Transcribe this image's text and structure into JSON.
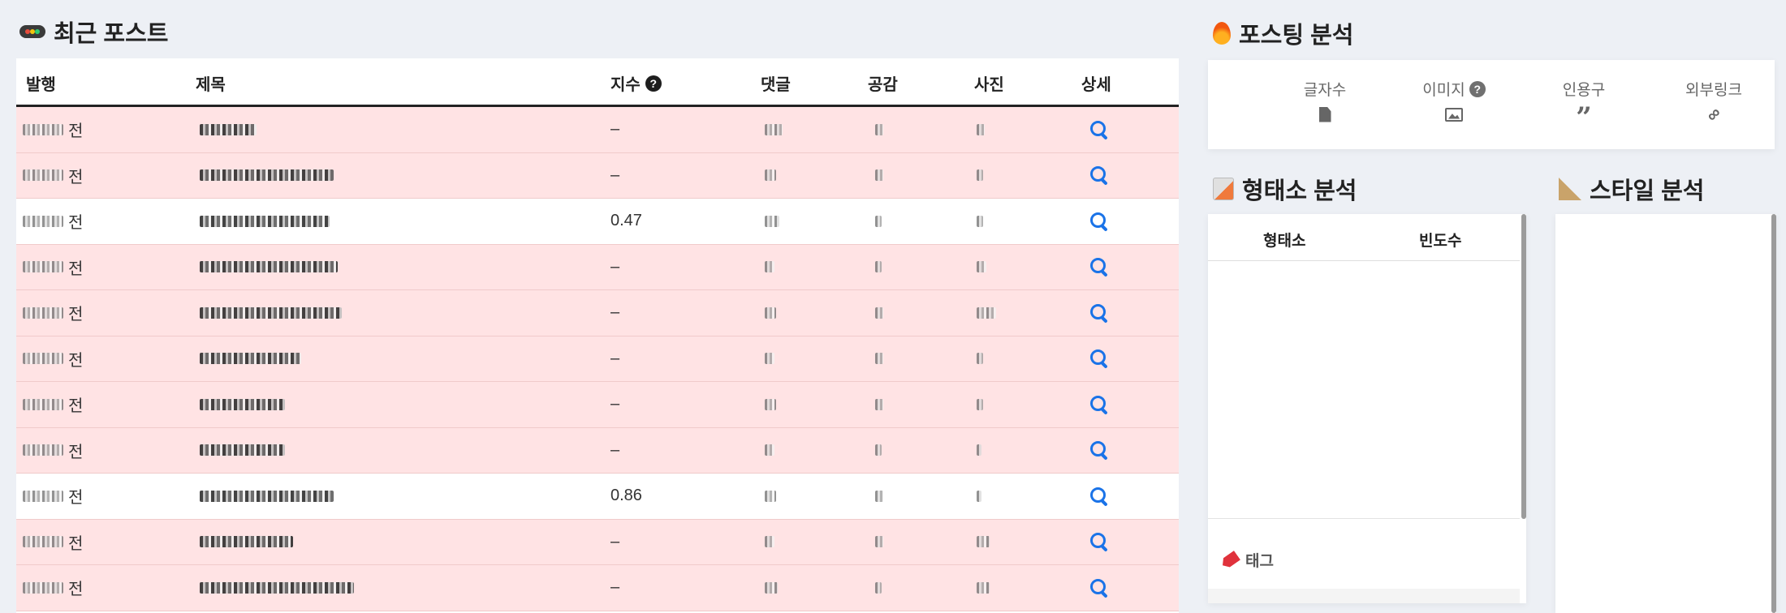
{
  "recent": {
    "title": "최근 포스트",
    "icon": "traffic-light-icon",
    "columns": {
      "published": "발행",
      "title": "제목",
      "index": "지수",
      "comments": "댓글",
      "likes": "공감",
      "photos": "사진",
      "detail": "상세"
    },
    "rows": [
      {
        "ago": "전",
        "index": "–",
        "highlight": true
      },
      {
        "ago": "전",
        "index": "–",
        "highlight": true
      },
      {
        "ago": "전",
        "index": "0.47",
        "highlight": false
      },
      {
        "ago": "전",
        "index": "–",
        "highlight": true
      },
      {
        "ago": "전",
        "index": "–",
        "highlight": true
      },
      {
        "ago": "전",
        "index": "–",
        "highlight": true
      },
      {
        "ago": "전",
        "index": "–",
        "highlight": true
      },
      {
        "ago": "전",
        "index": "–",
        "highlight": true
      },
      {
        "ago": "전",
        "index": "0.86",
        "highlight": false
      },
      {
        "ago": "전",
        "index": "–",
        "highlight": true
      },
      {
        "ago": "전",
        "index": "–",
        "highlight": true
      }
    ]
  },
  "posting": {
    "title": "포스팅 분석",
    "metrics": [
      {
        "label": "글자수",
        "icon": "file-icon"
      },
      {
        "label": "이미지",
        "icon": "image-icon",
        "help": true
      },
      {
        "label": "인용구",
        "icon": "quote-icon"
      },
      {
        "label": "외부링크",
        "icon": "link-icon"
      }
    ]
  },
  "morph": {
    "title": "형태소 분석",
    "col_morpheme": "형태소",
    "col_frequency": "빈도수",
    "tag_label": "태그"
  },
  "style": {
    "title": "스타일 분석"
  },
  "colors": {
    "row_highlight": "#ffe3e4",
    "accent": "#1a73e8",
    "background": "#edf0f5"
  }
}
